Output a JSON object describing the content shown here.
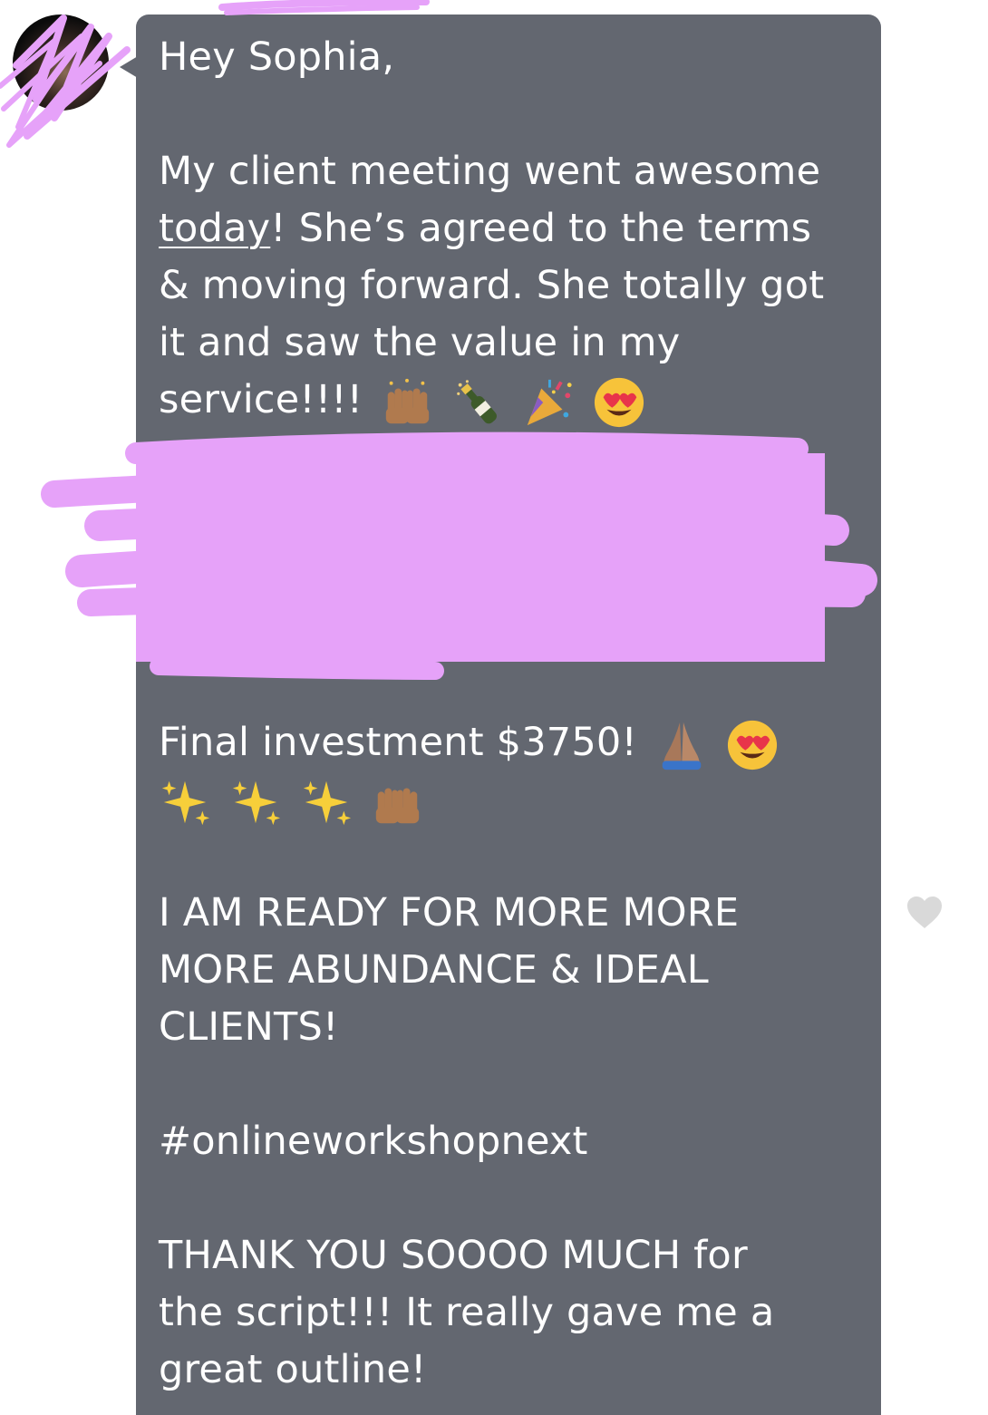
{
  "message": {
    "greeting": "Hey Sophia,",
    "line1": "My client meeting went awesome",
    "line2_underlined": "today",
    "line2_rest": "! She’s agreed to the terms",
    "line3": "& moving forward. She totally got",
    "line4": "it and saw the value in my",
    "line5": "service!!!!",
    "final": "Final investment $3750!",
    "ready1": "I AM READY FOR MORE MORE",
    "ready2": "MORE ABUNDANCE & IDEAL",
    "ready3": "CLIENTS!",
    "hashtag": "#onlineworkshopnext",
    "thanks1": "THANK YOU SOOOO MUCH for",
    "thanks2": "the script!!! It really gave me a",
    "thanks3": "great outline!"
  },
  "icons": {
    "avatar": "user-avatar",
    "like": "heart-icon",
    "redaction": "scribble-redaction"
  },
  "colors": {
    "bubble": "#636770",
    "text": "#ffffff",
    "scribble": "#e6a2f9",
    "heart": "#d9d9d9"
  }
}
